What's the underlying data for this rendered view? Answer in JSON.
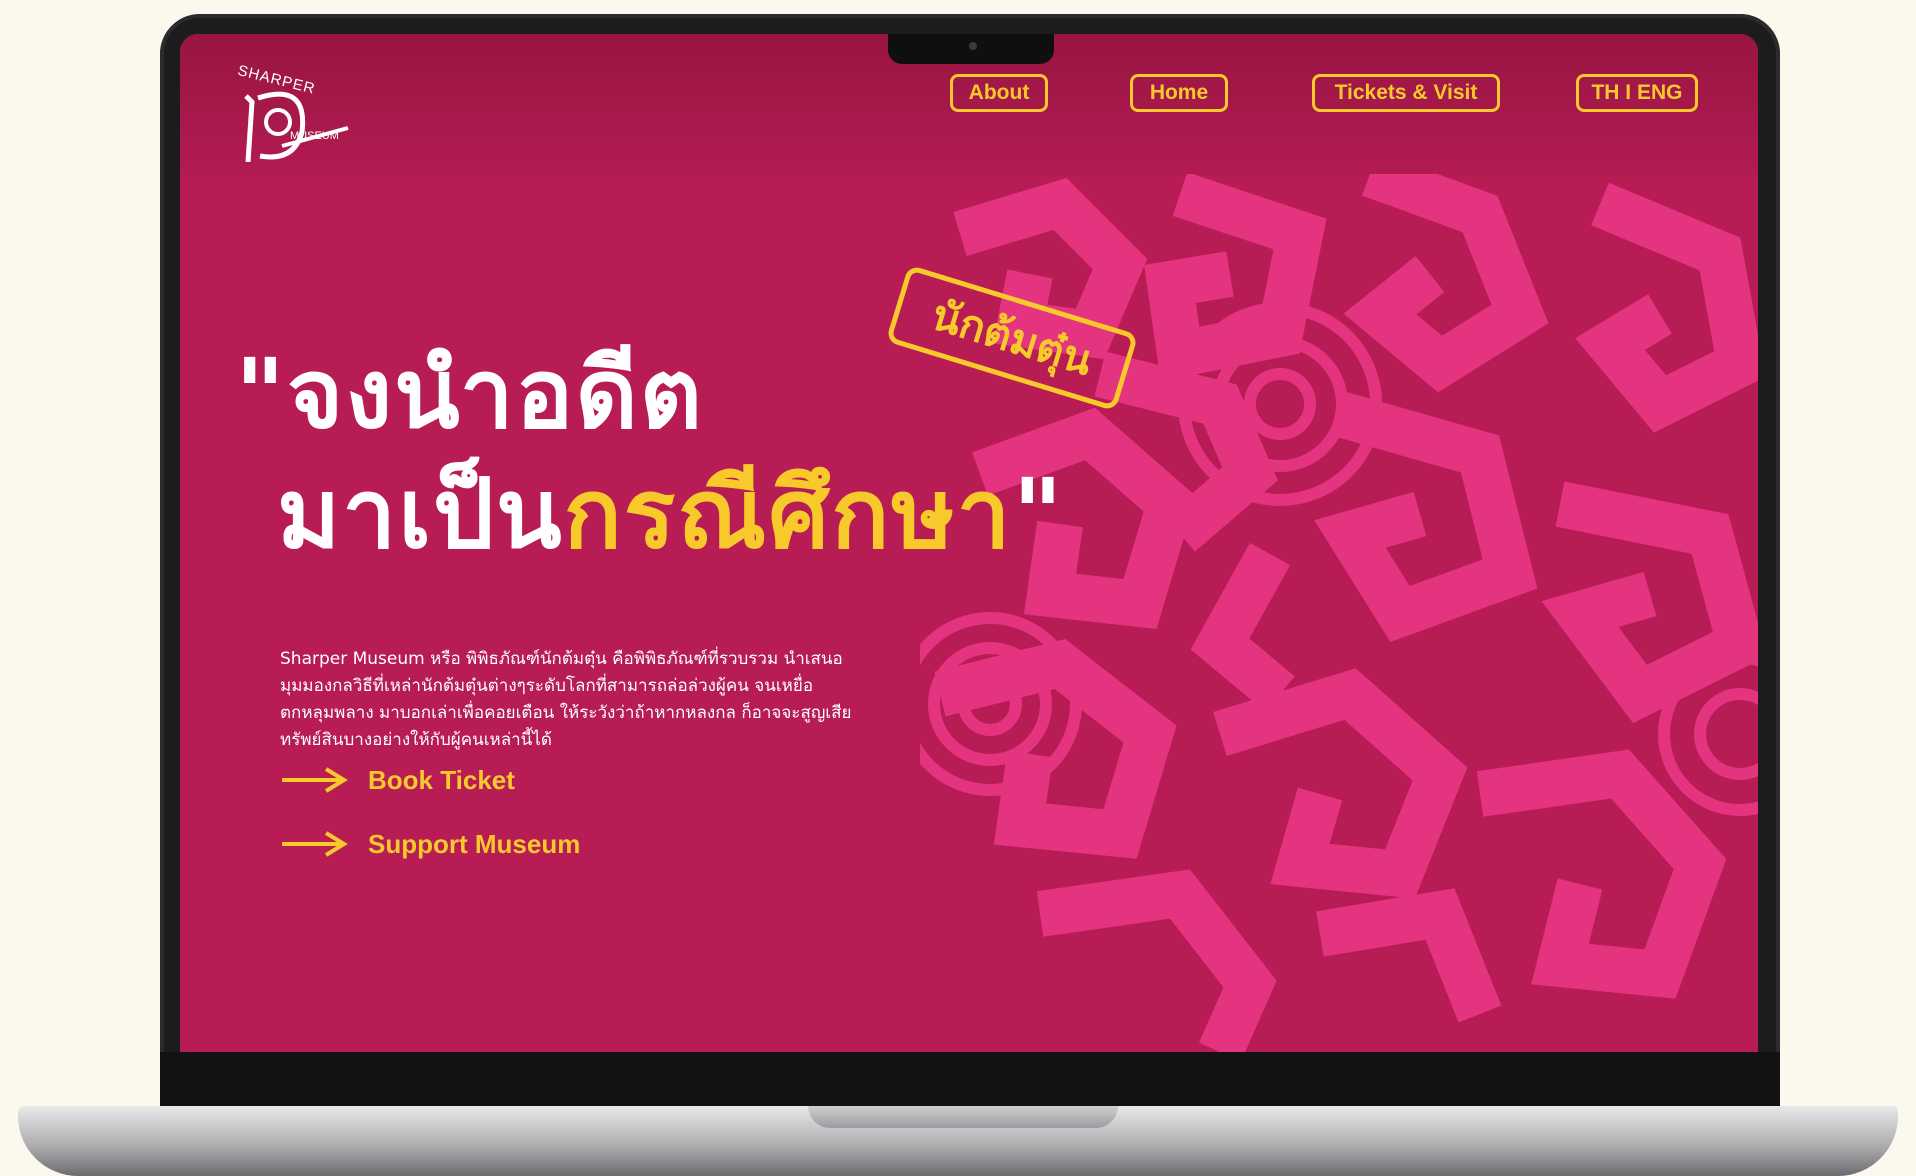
{
  "logo": {
    "top_text": "SHARPER",
    "bottom_text": "MUSEUM"
  },
  "nav": [
    {
      "label": "About"
    },
    {
      "label": "Home"
    },
    {
      "label": "Tickets & Visit"
    },
    {
      "label": "TH I ENG"
    }
  ],
  "hero": {
    "line1": "\"จงนำอดีต",
    "line2_white": "มาเป็น",
    "line2_highlight": "กรณีศึกษา",
    "line2_end": "\"",
    "stamp": "นักต้มตุ๋น",
    "description": "Sharper Museum หรือ พิพิธภัณฑ์นักต้มตุ๋น คือพิพิธภัณฑ์ที่รวบรวม นำเสนอมุมมองกลวิธีที่เหล่านักต้มตุ๋นต่างๆระดับโลกที่สามารถล่อล่วงผู้คน จนเหยื่อตกหลุมพลาง มาบอกเล่าเพื่อคอยเตือน ให้ระวังว่าถ้าหากหลงกล ก็อาจจะสูญเสียทรัพย์สินบางอย่างให้กับผู้คนเหล่านี้ได้"
  },
  "actions": [
    {
      "label": "Book Ticket"
    },
    {
      "label": "Support Museum"
    }
  ],
  "colors": {
    "background": "#b71c55",
    "accent": "#f7c92b",
    "pattern": "#e4347f"
  }
}
